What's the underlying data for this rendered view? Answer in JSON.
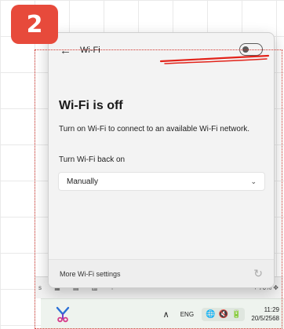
{
  "step_badge": {
    "number": "2",
    "color": "#e74a3b"
  },
  "wifi_panel": {
    "header": {
      "back_icon": "back-arrow-icon",
      "title": "Wi-Fi",
      "toggle_state": "off"
    },
    "status_heading": "Wi-Fi is off",
    "status_description": "Turn on Wi-Fi to connect to an available Wi-Fi network.",
    "turn_back_on_label": "Turn Wi-Fi back on",
    "turn_back_on_value": "Manually",
    "footer": {
      "more_link": "More Wi-Fi settings",
      "refresh_icon": "refresh-icon"
    }
  },
  "background_window": {
    "left_text": "s",
    "zoom_text": "76%"
  },
  "taskbar": {
    "app_icon": "snipping-tool-icon",
    "tray_caret_icon": "chevron-up-icon",
    "language": "ENG",
    "network_icon": "globe-icon",
    "volume_icon": "speaker-muted-icon",
    "battery_icon": "battery-icon",
    "time": "11:29",
    "date": "20/5/2568"
  },
  "colors": {
    "annotation_red": "#e74a3b",
    "panel_bg": "#f3f3f3",
    "taskbar_bg": "#eef3ee"
  }
}
